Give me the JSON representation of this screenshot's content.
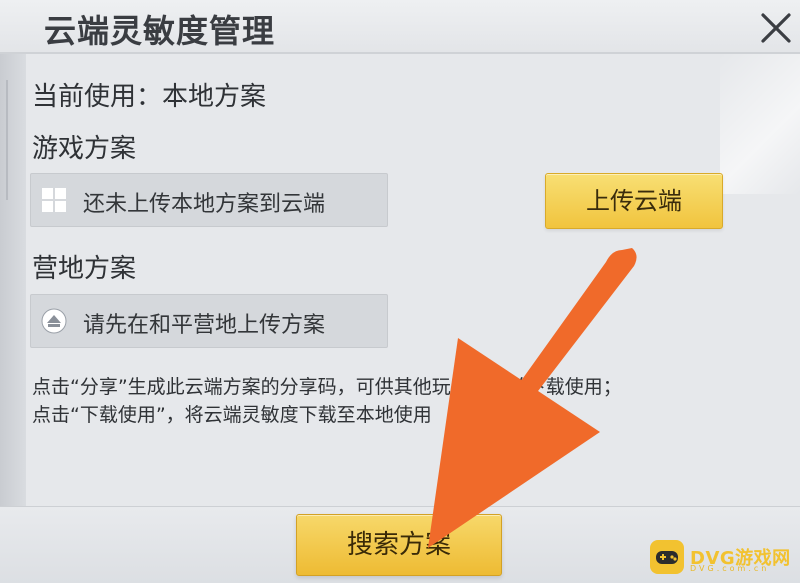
{
  "header": {
    "title": "云端灵敏度管理"
  },
  "current_use": {
    "text": "当前使用：本地方案"
  },
  "game_plan": {
    "label": "游戏方案",
    "status": "还未上传本地方案到云端",
    "upload_button": "上传云端",
    "icon": "grid-icon"
  },
  "camp_plan": {
    "label": "营地方案",
    "status": "请先在和平营地上传方案",
    "icon": "camp-logo-icon"
  },
  "hint": {
    "line1": "点击“分享”生成此云端方案的分享码，可供其他玩家搜索并下载使用；",
    "line2": "点击“下载使用”，将云端灵敏度下载至本地使用"
  },
  "footer": {
    "search_button": "搜索方案"
  },
  "watermark": {
    "brand": "DVG游戏网",
    "sub": "DVG.com.cn"
  },
  "colors": {
    "button_yellow": "#f1c43e",
    "arrow_orange": "#f06a2a",
    "panel_bg": "#e6e8eb"
  }
}
